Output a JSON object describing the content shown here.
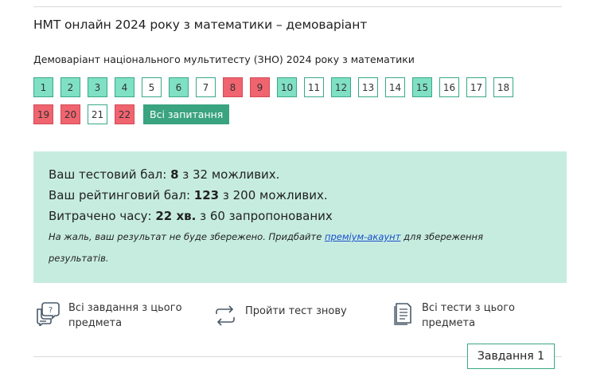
{
  "page": {
    "title": "НМТ онлайн 2024 року з математики – демоваріант",
    "subtitle": "Демоваріант національного мультитесту (ЗНО) 2024 року з математики"
  },
  "questions": {
    "row1": [
      {
        "n": "1",
        "status": "correct"
      },
      {
        "n": "2",
        "status": "correct"
      },
      {
        "n": "3",
        "status": "correct"
      },
      {
        "n": "4",
        "status": "correct"
      },
      {
        "n": "5",
        "status": "unanswered"
      },
      {
        "n": "6",
        "status": "correct"
      },
      {
        "n": "7",
        "status": "unanswered"
      },
      {
        "n": "8",
        "status": "wrong"
      },
      {
        "n": "9",
        "status": "wrong"
      },
      {
        "n": "10",
        "status": "correct"
      },
      {
        "n": "11",
        "status": "unanswered"
      },
      {
        "n": "12",
        "status": "correct"
      },
      {
        "n": "13",
        "status": "unanswered"
      },
      {
        "n": "14",
        "status": "unanswered"
      },
      {
        "n": "15",
        "status": "correct"
      },
      {
        "n": "16",
        "status": "unanswered"
      },
      {
        "n": "17",
        "status": "unanswered"
      },
      {
        "n": "18",
        "status": "unanswered"
      }
    ],
    "row2": [
      {
        "n": "19",
        "status": "wrong"
      },
      {
        "n": "20",
        "status": "wrong"
      },
      {
        "n": "21",
        "status": "unanswered"
      },
      {
        "n": "22",
        "status": "wrong"
      }
    ],
    "all_label": "Всі запитання"
  },
  "results": {
    "test_score_prefix": "Ваш тестовий бал: ",
    "test_score": "8",
    "test_score_suffix": " з 32 можливих.",
    "rating_prefix": "Ваш рейтинговий бал: ",
    "rating": "123",
    "rating_suffix": " з 200 можливих.",
    "time_prefix": "Витрачено часу: ",
    "time": "22 хв.",
    "time_suffix": " з 60 запропонованих",
    "note_before": "На жаль, ваш результат не буде збережено. Придбайте ",
    "note_link": "преміум-акаунт",
    "note_after": " для збереження",
    "note_line2": "результатів."
  },
  "actions": {
    "all_tasks": {
      "line1": "Всі завдання з цього",
      "line2": "предмета",
      "icon": "chat-question-icon"
    },
    "retry": {
      "label": "Пройти тест знову",
      "icon": "repeat-arrows-icon"
    },
    "all_tests": {
      "line1": "Всі тести з цього",
      "line2": "предмета",
      "icon": "document-list-icon"
    }
  },
  "footer": {
    "task_button": "Завдання 1"
  },
  "colors": {
    "correct": "#7fe0c4",
    "wrong": "#f0646f",
    "accent": "#3aa37f",
    "panel": "#c6ece0"
  }
}
